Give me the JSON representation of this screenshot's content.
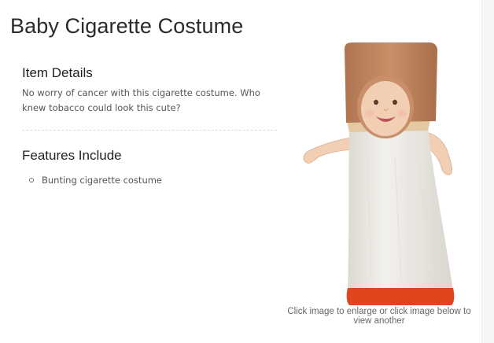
{
  "page": {
    "title": "Baby Cigarette Costume"
  },
  "item_details": {
    "heading": "Item Details",
    "text": "No worry of cancer with this cigarette costume. Who knew tobacco could look this cute?"
  },
  "features": {
    "heading": "Features Include",
    "items": [
      "Bunting cigarette costume"
    ]
  },
  "product_image": {
    "alt": "Baby wearing a cigarette bunting costume",
    "caption": "Click image to enlarge or click image below to view another"
  },
  "colors": {
    "filter": "#c58a64",
    "paper": "#f1efea",
    "tip": "#e0461e",
    "skin": "#f2cfb3"
  }
}
